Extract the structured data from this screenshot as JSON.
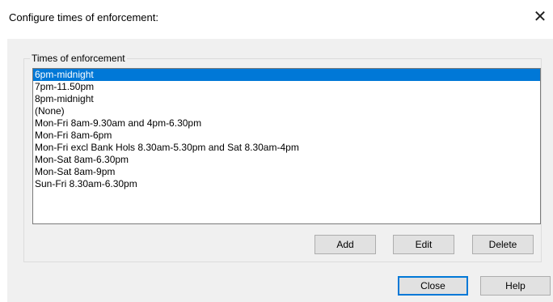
{
  "window": {
    "title": "Configure times of enforcement:",
    "close_glyph": "✕"
  },
  "group": {
    "legend": "Times of enforcement",
    "items": [
      {
        "label": "6pm-midnight",
        "selected": true
      },
      {
        "label": "7pm-11.50pm",
        "selected": false
      },
      {
        "label": "8pm-midnight",
        "selected": false
      },
      {
        "label": "(None)",
        "selected": false
      },
      {
        "label": "Mon-Fri 8am-9.30am and 4pm-6.30pm",
        "selected": false
      },
      {
        "label": "Mon-Fri 8am-6pm",
        "selected": false
      },
      {
        "label": "Mon-Fri excl Bank Hols 8.30am-5.30pm and Sat 8.30am-4pm",
        "selected": false
      },
      {
        "label": "Mon-Sat 8am-6.30pm",
        "selected": false
      },
      {
        "label": "Mon-Sat 8am-9pm",
        "selected": false
      },
      {
        "label": "Sun-Fri 8.30am-6.30pm",
        "selected": false
      }
    ]
  },
  "buttons": {
    "add": "Add",
    "edit": "Edit",
    "delete": "Delete",
    "close": "Close",
    "help": "Help"
  },
  "colors": {
    "selection": "#0078d7",
    "default_button_border": "#0078d7"
  }
}
